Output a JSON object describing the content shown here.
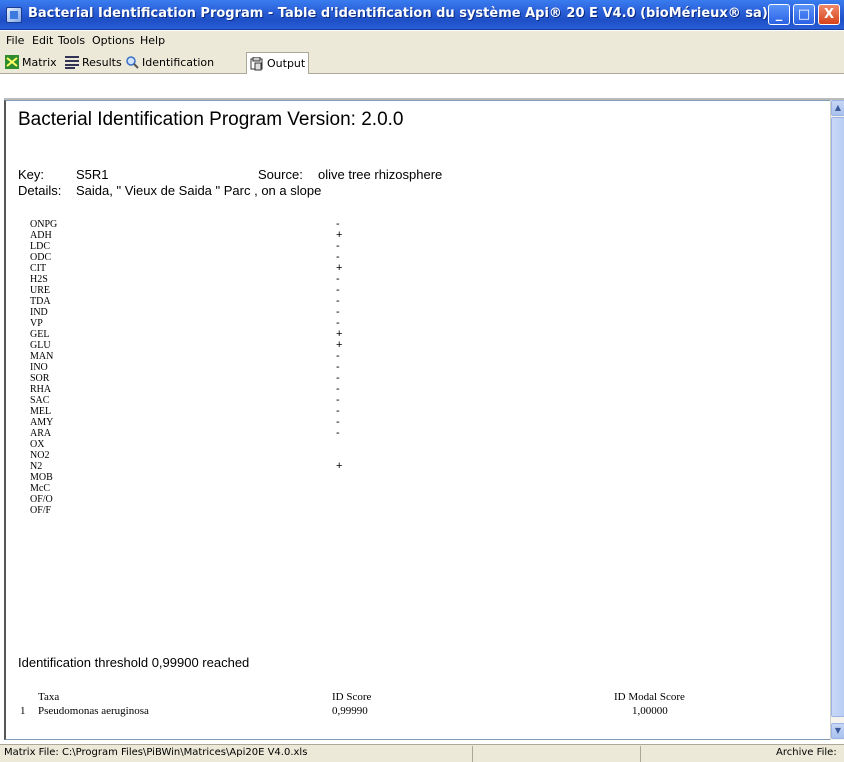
{
  "window": {
    "title": "Bacterial Identification Program - Table d'identification du système Api® 20 E V4.0 (bioMérieux® sa)",
    "minimize_glyph": "_",
    "maximize_glyph": "□",
    "close_glyph": "X"
  },
  "menu": {
    "items": [
      "File",
      "Edit",
      "Tools",
      "Options",
      "Help"
    ]
  },
  "toolbar": {
    "buttons": [
      {
        "label": "Matrix",
        "icon": "matrix-icon"
      },
      {
        "label": "Results",
        "icon": "results-icon"
      },
      {
        "label": "Identification",
        "icon": "magnifier-icon"
      },
      {
        "label": "Output",
        "icon": "output-icon"
      }
    ],
    "active": "Output"
  },
  "report": {
    "heading": "Bacterial Identification Program Version: 2.0.0",
    "key_label": "Key:",
    "key_value": "S5R1",
    "source_label": "Source:",
    "source_value": "olive tree rhizosphere",
    "details_label": "Details:",
    "details_value": "Saida, \" Vieux de Saida \" Parc , on a slope",
    "tests": [
      {
        "name": "ONPG",
        "value": "-"
      },
      {
        "name": "ADH",
        "value": "+"
      },
      {
        "name": "LDC",
        "value": "-"
      },
      {
        "name": "ODC",
        "value": "-"
      },
      {
        "name": "CIT",
        "value": "+"
      },
      {
        "name": "H2S",
        "value": "-"
      },
      {
        "name": "URE",
        "value": "-"
      },
      {
        "name": "TDA",
        "value": "-"
      },
      {
        "name": "IND",
        "value": "-"
      },
      {
        "name": "VP",
        "value": "-"
      },
      {
        "name": "GEL",
        "value": "+"
      },
      {
        "name": "GLU",
        "value": "+"
      },
      {
        "name": "MAN",
        "value": "-"
      },
      {
        "name": "INO",
        "value": "-"
      },
      {
        "name": "SOR",
        "value": "-"
      },
      {
        "name": "RHA",
        "value": "-"
      },
      {
        "name": "SAC",
        "value": "-"
      },
      {
        "name": "MEL",
        "value": "-"
      },
      {
        "name": "AMY",
        "value": "-"
      },
      {
        "name": "ARA",
        "value": "-"
      },
      {
        "name": "OX",
        "value": ""
      },
      {
        "name": "NO2",
        "value": ""
      },
      {
        "name": "N2",
        "value": "+"
      },
      {
        "name": "MOB",
        "value": ""
      },
      {
        "name": "McC",
        "value": ""
      },
      {
        "name": "OF/O",
        "value": ""
      },
      {
        "name": "OF/F",
        "value": ""
      }
    ],
    "threshold_text": "Identification threshold 0,99900 reached",
    "results_header": {
      "taxa": "Taxa",
      "id_score": "ID Score",
      "id_modal_score": "ID Modal Score"
    },
    "results": [
      {
        "rank": "1",
        "taxa": "Pseudomonas aeruginosa",
        "id_score": "0,99990",
        "id_modal_score": "1,00000"
      }
    ]
  },
  "statusbar": {
    "matrix_file": "Matrix File: C:\\Program Files\\PiBWin\\Matrices\\Api20E V4.0.xls",
    "archive_file": "Archive File:"
  },
  "colors": {
    "titlebar": "#2a5fd8",
    "chrome": "#ece9d8",
    "close_button": "#d8421a"
  }
}
